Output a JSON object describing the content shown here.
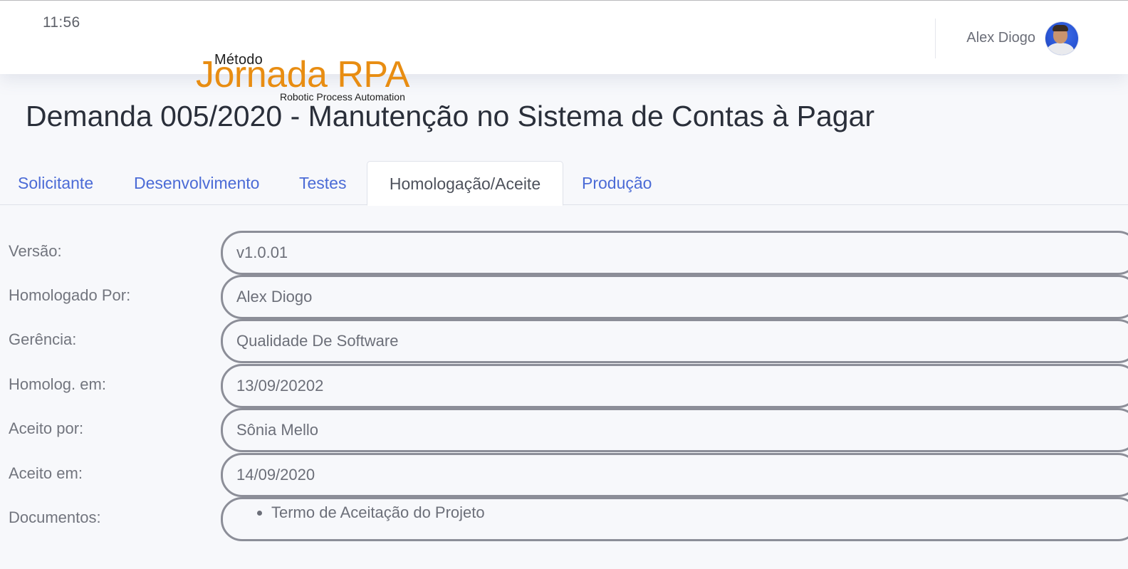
{
  "header": {
    "time": "11:56",
    "user_name": "Alex Diogo",
    "avatar_icon": "user-avatar"
  },
  "logo": {
    "small_text": "Método",
    "main_text": "Jornada RPA",
    "sub_text": "Robotic Process Automation",
    "color": "#e88d12"
  },
  "page": {
    "title": "Demanda 005/2020 - Manutenção no Sistema de Contas à Pagar"
  },
  "tabs": [
    {
      "label": "Solicitante",
      "active": false
    },
    {
      "label": "Desenvolvimento",
      "active": false
    },
    {
      "label": "Testes",
      "active": false
    },
    {
      "label": "Homologação/Aceite",
      "active": true
    },
    {
      "label": "Produção",
      "active": false
    }
  ],
  "form": {
    "fields": [
      {
        "label": "Versão:",
        "value": "v1.0.01"
      },
      {
        "label": "Homologado Por:",
        "value": "Alex Diogo"
      },
      {
        "label": "Gerência:",
        "value": "Qualidade De Software"
      },
      {
        "label": "Homolog. em:",
        "value": "13/09/20202"
      },
      {
        "label": "Aceito por:",
        "value": "Sônia Mello"
      },
      {
        "label": "Aceito em:",
        "value": "14/09/2020"
      }
    ],
    "documents_label": "Documentos:",
    "documents": [
      "Termo de Aceitação do Projeto"
    ]
  },
  "colors": {
    "link": "#4b6bd6",
    "field_border": "#8c8e98",
    "background": "#f7f8fb"
  }
}
